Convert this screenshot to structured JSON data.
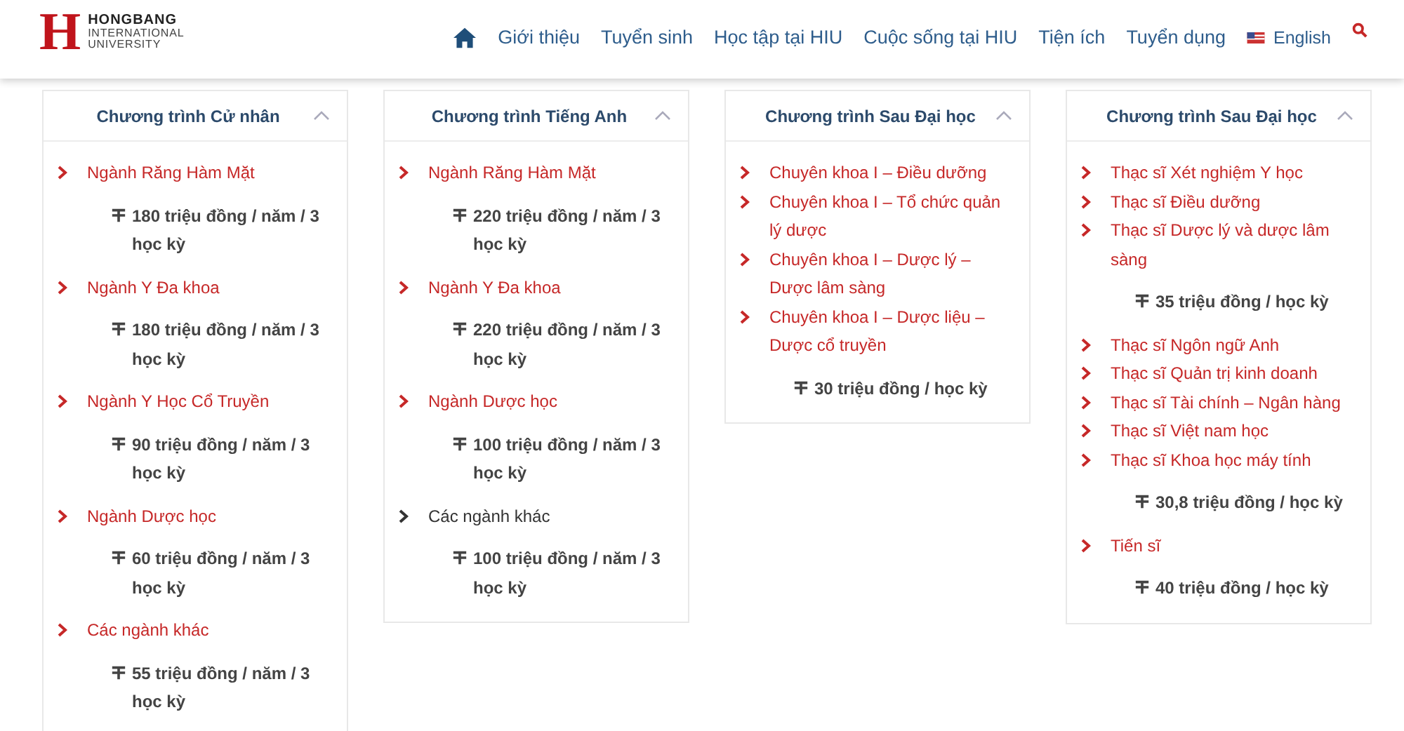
{
  "logo": {
    "letter": "H",
    "name": "HONGBANG",
    "subtitle_lines": [
      "INTERNATIONAL",
      "UNIVERSITY"
    ]
  },
  "nav": {
    "items": [
      "Giới thiệu",
      "Tuyển sinh",
      "Học tập tại HIU",
      "Cuộc sống tại HIU",
      "Tiện ích",
      "Tuyển dụng"
    ],
    "language": "English"
  },
  "cards": [
    {
      "title": "Chương trình Cử nhân",
      "expanded": true,
      "groups": [
        {
          "links": [
            {
              "text": "Ngành Răng Hàm Mặt",
              "linked": true
            }
          ],
          "price": "180 triệu đồng / năm / 3 học kỳ"
        },
        {
          "links": [
            {
              "text": "Ngành Y Đa khoa",
              "linked": true
            }
          ],
          "price": "180 triệu đồng / năm / 3 học kỳ"
        },
        {
          "links": [
            {
              "text": "Ngành Y Học Cổ Truyền",
              "linked": true
            }
          ],
          "price": "90 triệu đồng / năm / 3 học kỳ"
        },
        {
          "links": [
            {
              "text": "Ngành Dược học",
              "linked": true
            }
          ],
          "price": "60 triệu đồng / năm / 3 học kỳ"
        },
        {
          "links": [
            {
              "text": "Các ngành khác",
              "linked": true
            }
          ],
          "price": "55 triệu đồng / năm / 3 học kỳ"
        }
      ]
    },
    {
      "title": "Chương trình Tiếng Anh",
      "expanded": true,
      "groups": [
        {
          "links": [
            {
              "text": "Ngành Răng Hàm Mặt",
              "linked": true
            }
          ],
          "price": "220 triệu đồng / năm / 3 học kỳ"
        },
        {
          "links": [
            {
              "text": "Ngành Y Đa khoa",
              "linked": true
            }
          ],
          "price": "220 triệu đồng / năm / 3 học kỳ"
        },
        {
          "links": [
            {
              "text": "Ngành Dược học",
              "linked": true
            }
          ],
          "price": "100 triệu đồng / năm / 3 học kỳ"
        },
        {
          "links": [
            {
              "text": "Các ngành khác",
              "linked": false
            }
          ],
          "price": "100 triệu đồng / năm / 3 học kỳ"
        }
      ]
    },
    {
      "title": "Chương trình Sau Đại học",
      "expanded": true,
      "groups": [
        {
          "links": [
            {
              "text": "Chuyên khoa I – Điều dưỡng",
              "linked": true
            },
            {
              "text": "Chuyên khoa I – Tổ chức quản lý dược",
              "linked": true
            },
            {
              "text": "Chuyên khoa I – Dược lý – Dược lâm sàng",
              "linked": true
            },
            {
              "text": "Chuyên khoa I – Dược liệu – Dược cổ truyền",
              "linked": true
            }
          ],
          "price": "30 triệu đồng / học kỳ"
        }
      ]
    },
    {
      "title": "Chương trình Sau Đại học",
      "expanded": true,
      "groups": [
        {
          "links": [
            {
              "text": "Thạc sĩ Xét nghiệm Y học",
              "linked": true
            },
            {
              "text": "Thạc sĩ Điều dưỡng",
              "linked": true
            },
            {
              "text": "Thạc sĩ Dược lý và dược lâm sàng",
              "linked": true
            }
          ],
          "price": "35 triệu đồng / học kỳ"
        },
        {
          "links": [
            {
              "text": "Thạc sĩ Ngôn ngữ Anh",
              "linked": true
            },
            {
              "text": "Thạc sĩ Quản trị kinh doanh",
              "linked": true
            },
            {
              "text": "Thạc sĩ Tài chính – Ngân hàng",
              "linked": true
            },
            {
              "text": "Thạc sĩ Việt nam học",
              "linked": true
            },
            {
              "text": "Thạc sĩ Khoa học máy tính",
              "linked": true
            }
          ],
          "price": "30,8 triệu đồng / học kỳ"
        },
        {
          "links": [
            {
              "text": "Tiến sĩ",
              "linked": true
            }
          ],
          "price": "40 triệu đồng / học kỳ"
        }
      ]
    }
  ]
}
